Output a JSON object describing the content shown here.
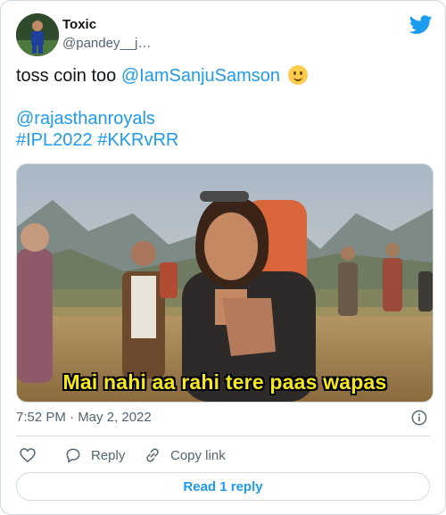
{
  "tweet": {
    "author_name": "Toxic",
    "author_handle": "@pandey__j…",
    "text_line1_plain": "toss coin too ",
    "text_line1_mention": "@IamSanjuSamson",
    "mention2": "@rajasthanroyals",
    "hashtags": "#IPL2022 #KKRvRR",
    "media_caption": "Mai nahi aa rahi tere paas wapas",
    "timestamp": "7:52 PM · May 2, 2022"
  },
  "actions": {
    "like_icon": "heart-icon",
    "reply_label": "Reply",
    "copy_label": "Copy link",
    "read_replies_label": "Read 1 reply"
  },
  "colors": {
    "accent": "#1d9bf0",
    "text_secondary": "#536471",
    "border": "#cfd9de",
    "caption_yellow": "#f5e81c"
  }
}
